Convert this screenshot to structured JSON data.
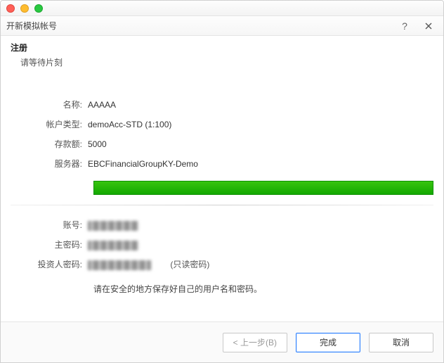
{
  "window": {
    "title": "开新模拟帐号"
  },
  "section": {
    "title": "注册",
    "subtitle": "请等待片刻"
  },
  "fields": {
    "name_label": "名称:",
    "name_value": "AAAAA",
    "account_type_label": "帐户类型:",
    "account_type_value": "demoAcc-STD (1:100)",
    "deposit_label": "存款额:",
    "deposit_value": "5000",
    "server_label": "服务器:",
    "server_value": "EBCFinancialGroupKY-Demo",
    "login_label": "账号:",
    "password_label": "主密码:",
    "investor_label": "投资人密码:",
    "readonly_hint": "(只读密码)"
  },
  "progress": {
    "percent": 100
  },
  "note": "请在安全的地方保存好自己的用户名和密码。",
  "footer": {
    "back": "< 上一步(B)",
    "finish": "完成",
    "cancel": "取消"
  }
}
